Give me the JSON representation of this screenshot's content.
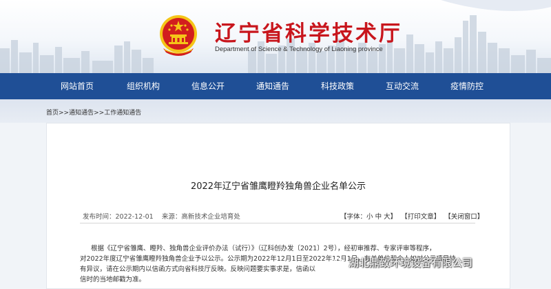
{
  "header": {
    "title": "辽宁省科学技术厅",
    "subtitle": "Department of Science & Technology of Liaoning province",
    "colors": {
      "title": "#c8161d",
      "nav_bg": "#1f4f96",
      "emblem_red": "#d21e1e",
      "emblem_gold": "#f5c518"
    }
  },
  "nav": {
    "items": [
      "网站首页",
      "组织机构",
      "信息公开",
      "通知通告",
      "科技政策",
      "互动交流",
      "疫情防控"
    ]
  },
  "breadcrumb": {
    "items": [
      "首页",
      "通知通告",
      "工作通知通告"
    ],
    "separator": ">>"
  },
  "article": {
    "title": "2022年辽宁省雏鹰瞪羚独角兽企业名单公示",
    "published_label": "发布时间：",
    "published_date": "2022-12-01",
    "source_label": "来源：",
    "source": "高新技术企业培育处",
    "font_label": "【字体：",
    "font_sizes": [
      "小",
      "中",
      "大"
    ],
    "font_close": "】",
    "print_label": "【打印文章】",
    "close_label": "【关闭窗口】",
    "paragraphs": [
      "根据《辽宁省雏鹰、瞪羚、独角兽企业评价办法（试行）》（辽科创办发〔2021〕2号），经初审推荐、专家评审等程序，",
      "对2022年度辽宁省雏鹰瞪羚独角兽企业予以公示。公示期为2022年12月1日至2022年12月1日，有关单位和个人如对公示项目持",
      "有异议，请在公示期内以信函方式向省科技厅反映。反映问题要实事求是，信函以",
      "信时的当地邮戳为准。"
    ]
  },
  "watermark": {
    "text": "湖北鼎致环境设备有限公司",
    "icon": "wechat-logo-icon"
  }
}
